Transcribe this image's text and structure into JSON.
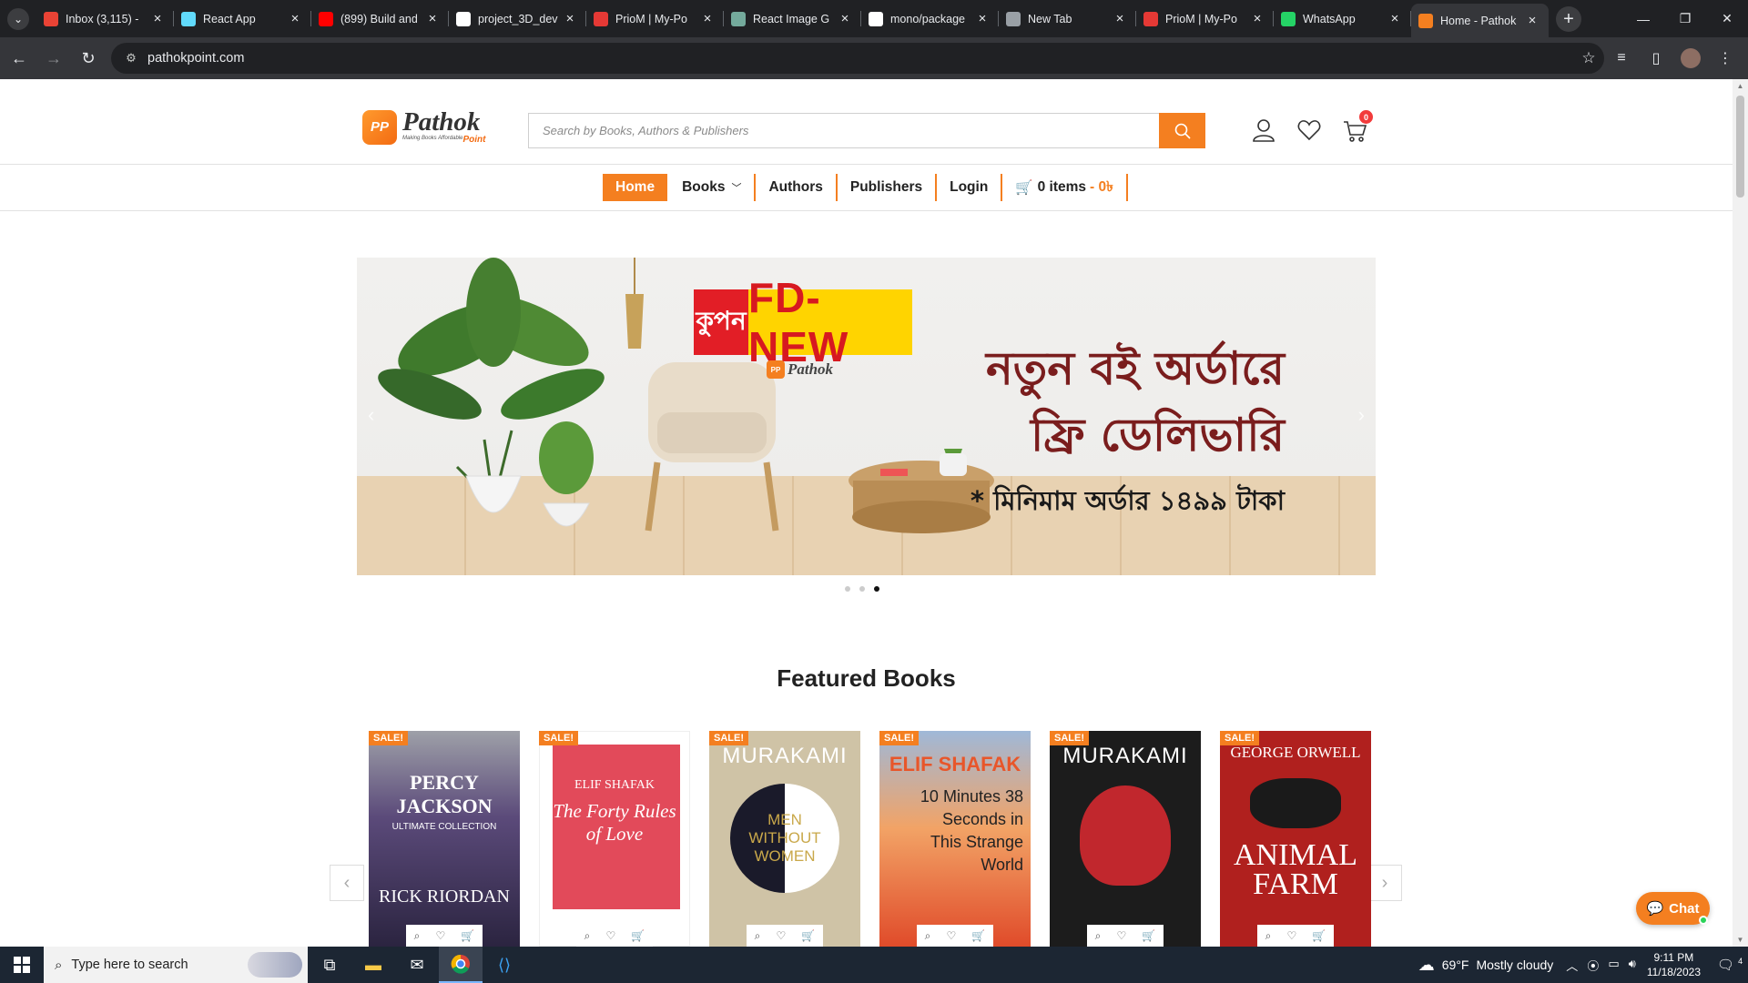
{
  "browser": {
    "tabs": [
      {
        "title": "Inbox (3,115) -",
        "icon": "gmail-icon",
        "color": "#ea4335"
      },
      {
        "title": "React App",
        "icon": "react-icon",
        "color": "#61dafb"
      },
      {
        "title": "(899) Build and",
        "icon": "youtube-icon",
        "color": "#ff0000"
      },
      {
        "title": "project_3D_dev",
        "icon": "github-icon",
        "color": "#ffffff"
      },
      {
        "title": "PrioM | My-Po",
        "icon": "priom-icon",
        "color": "#e53935"
      },
      {
        "title": "React Image G",
        "icon": "openai-icon",
        "color": "#74aa9c"
      },
      {
        "title": "mono/package",
        "icon": "github-icon",
        "color": "#ffffff"
      },
      {
        "title": "New Tab",
        "icon": "chrome-icon",
        "color": "#9aa0a6"
      },
      {
        "title": "PrioM | My-Po",
        "icon": "priom-icon",
        "color": "#e53935"
      },
      {
        "title": "WhatsApp",
        "icon": "whatsapp-icon",
        "color": "#25d366"
      },
      {
        "title": "Home - Pathok",
        "icon": "pathok-icon",
        "color": "#f47f20"
      }
    ],
    "url": "pathokpoint.com"
  },
  "site": {
    "logo": {
      "name": "Pathok",
      "tagline": "Making Books Affordable",
      "point": "Point"
    },
    "search_placeholder": "Search by Books, Authors & Publishers",
    "cart_count": "0",
    "nav": {
      "home": "Home",
      "books": "Books",
      "authors": "Authors",
      "publishers": "Publishers",
      "login": "Login",
      "cart_items": "0 items",
      "cart_price": "- 0৳"
    },
    "banner": {
      "coupon_label": "কুপন",
      "coupon_code": "FD-NEW",
      "logo_text": "Pathok",
      "line1": "নতুন বই অর্ডারে",
      "line2": "ফ্রি ডেলিভারি",
      "line3": "* মিনিমাম অর্ডার ১৪৯৯ টাকা",
      "active_slide": 3,
      "slide_count": 3
    },
    "featured_title": "Featured Books",
    "sale_label": "SALE!",
    "books": [
      {
        "title": "PERCY JACKSON",
        "subtitle": "ULTIMATE COLLECTION",
        "author": "RICK RIORDAN"
      },
      {
        "title": "The Forty Rules of Love",
        "subtitle": "",
        "author": "ELIF SHAFAK"
      },
      {
        "title": "MEN WITHOUT WOMEN",
        "subtitle": "",
        "author": "MURAKAMI"
      },
      {
        "title": "10 Minutes 38 Seconds in This Strange World",
        "subtitle": "",
        "author": "ELIF SHAFAK"
      },
      {
        "title": "",
        "subtitle": "",
        "author": "MURAKAMI"
      },
      {
        "title": "ANIMAL FARM",
        "subtitle": "",
        "author": "GEORGE ORWELL"
      }
    ],
    "chat_label": "Chat"
  },
  "taskbar": {
    "search_placeholder": "Type here to search",
    "weather_temp": "69°F",
    "weather_desc": "Mostly cloudy",
    "time": "9:11 PM",
    "date": "11/18/2023",
    "notification_count": "4"
  },
  "colors": {
    "accent": "#f47f20",
    "chrome_dark": "#202124",
    "chrome_mid": "#35363a"
  }
}
